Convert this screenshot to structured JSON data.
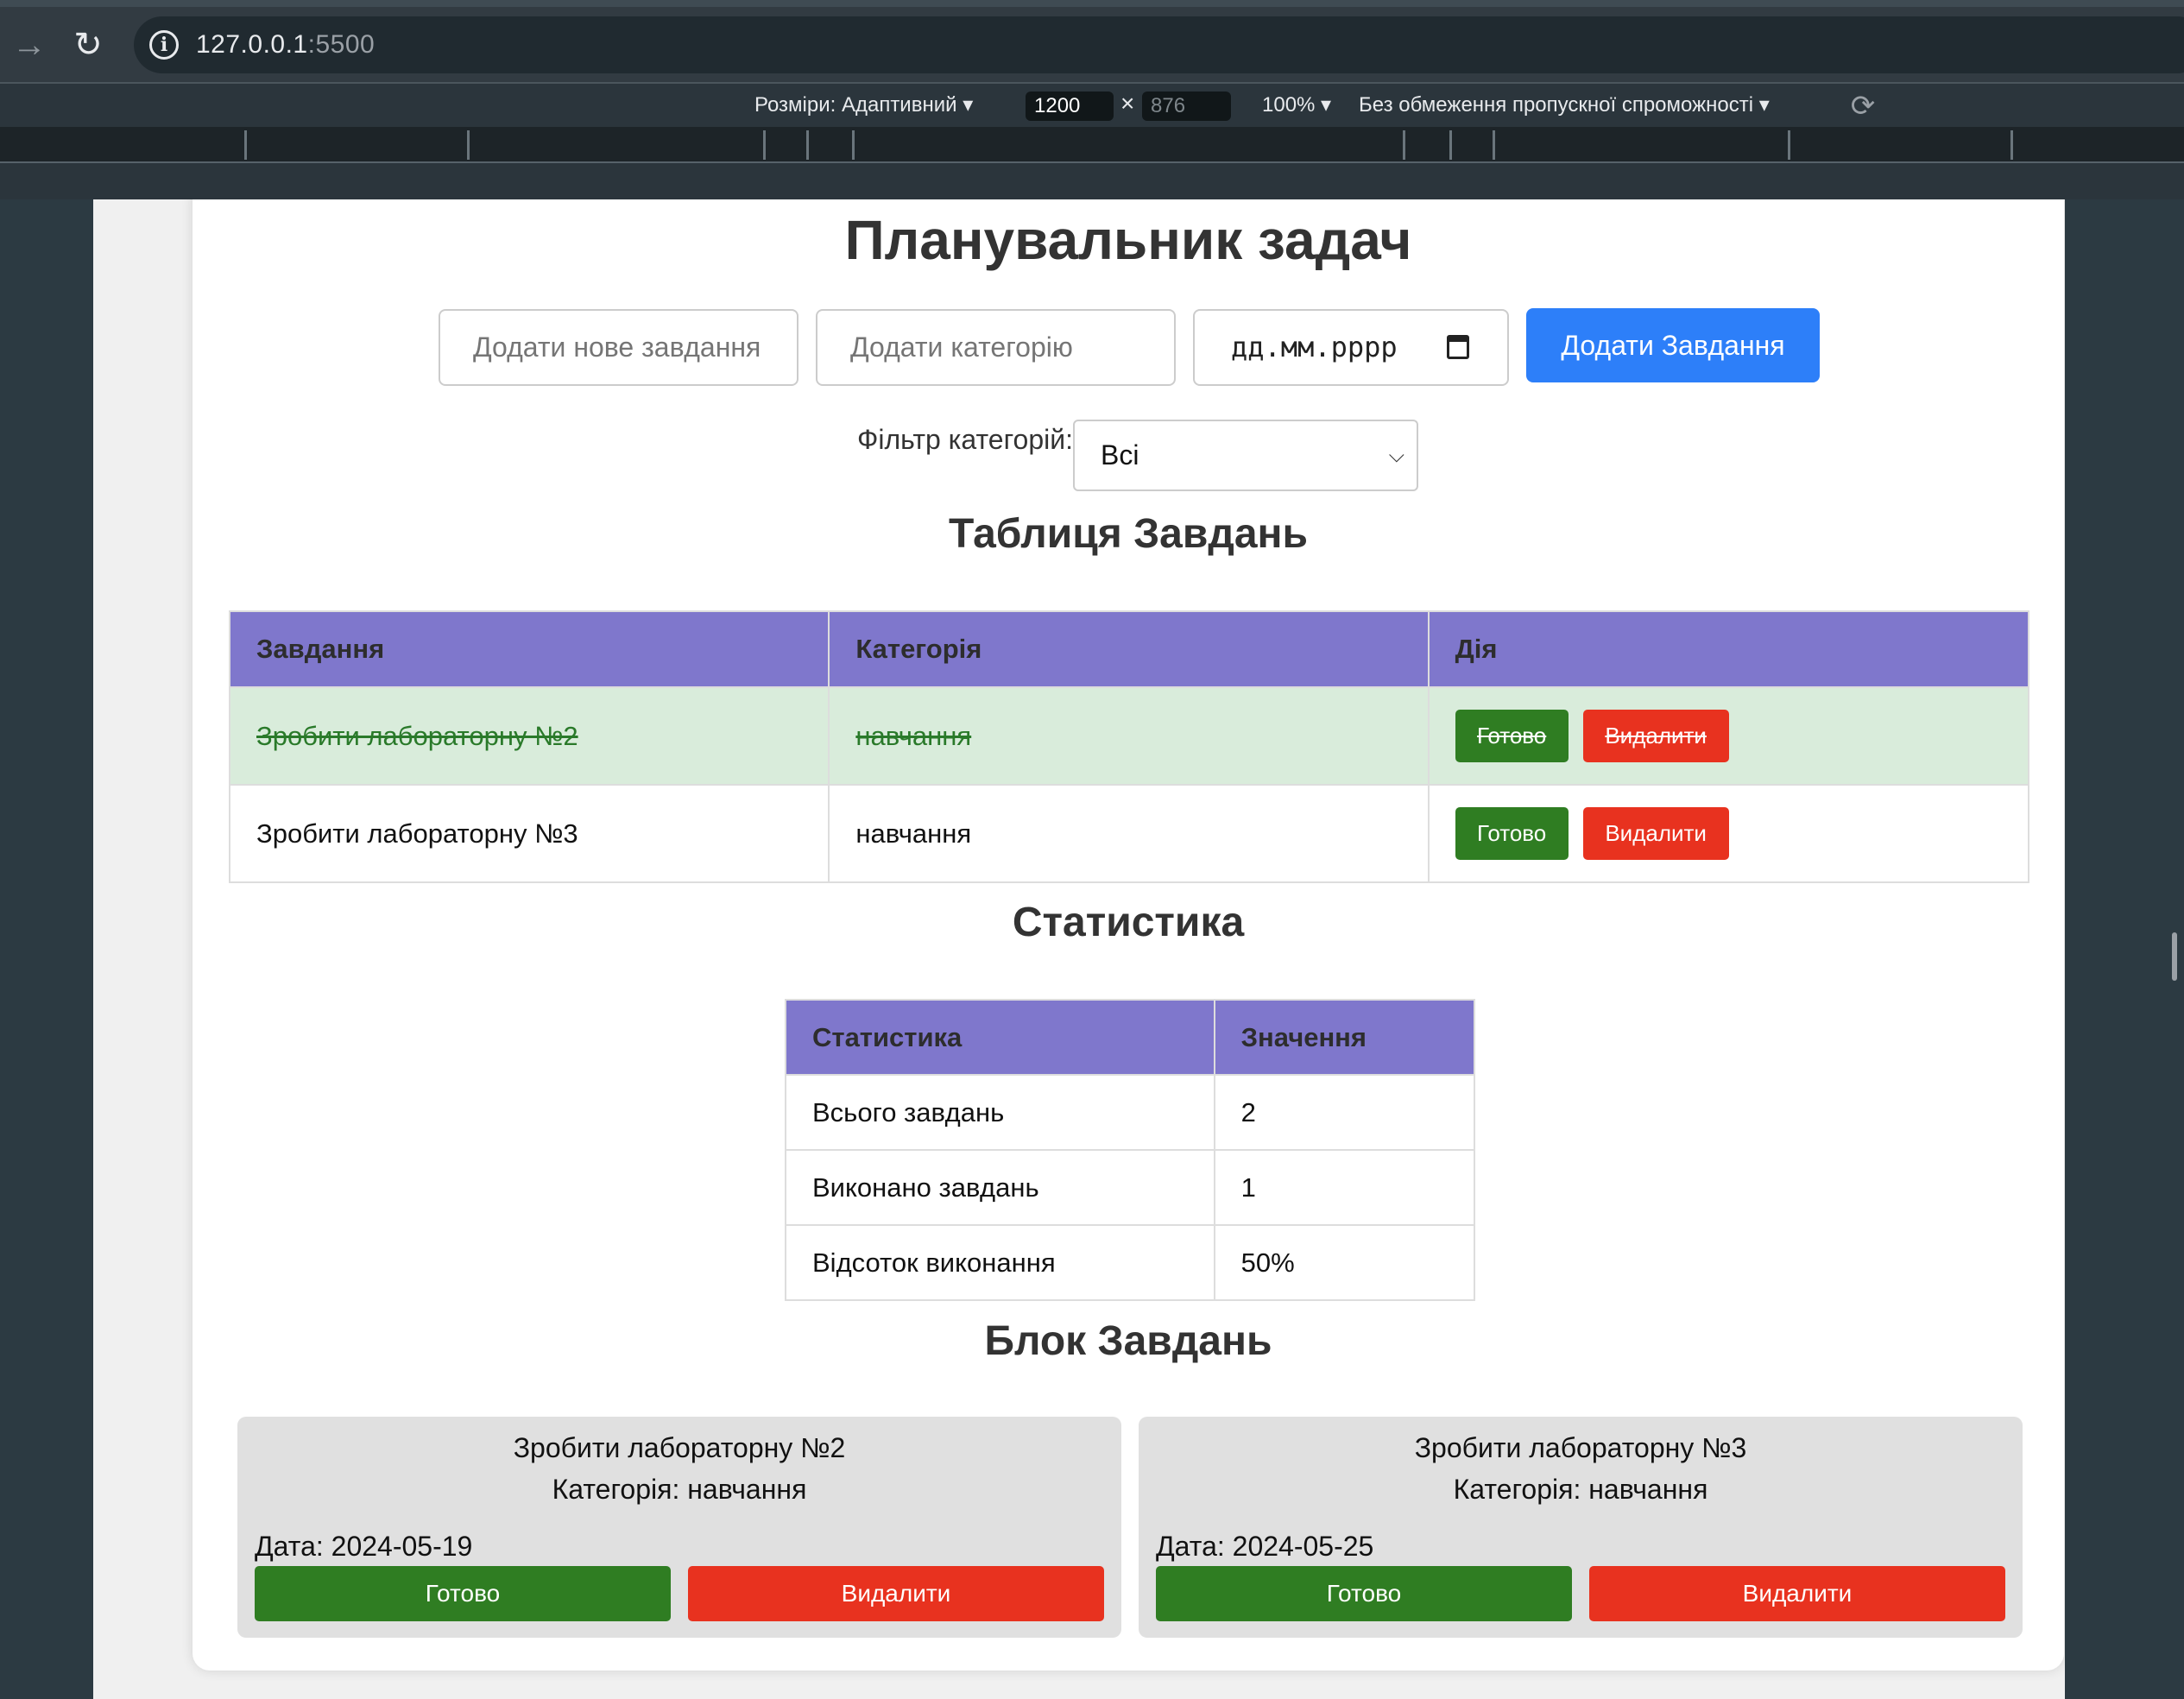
{
  "browser": {
    "url_host": "127.0.0.1",
    "url_port": ":5500"
  },
  "device_toolbar": {
    "dimensions_label": "Розміри: Адаптивний",
    "width_value": "1200",
    "height_value": "876",
    "times": "×",
    "zoom_label": "100%",
    "throttle_label": "Без обмеження пропускної спроможності"
  },
  "page": {
    "title": "Планувальник задач",
    "inputs": {
      "task_placeholder": "Додати нове завдання",
      "category_placeholder": "Додати категорію",
      "date_placeholder": "дд.мм.рррр"
    },
    "add_button": "Додати Завдання",
    "filter": {
      "label": "Фільтр категорій:",
      "selected": "Всі"
    },
    "task_table": {
      "heading": "Таблиця Завдань",
      "headers": [
        "Завдання",
        "Категорія",
        "Дія"
      ],
      "rows": [
        {
          "task": "Зробити лабораторну №2",
          "category": "навчання",
          "done": true,
          "done_label": "Готово",
          "delete_label": "Видалити"
        },
        {
          "task": "Зробити лабораторну №3",
          "category": "навчання",
          "done": false,
          "done_label": "Готово",
          "delete_label": "Видалити"
        }
      ]
    },
    "stats": {
      "heading": "Статистика",
      "headers": [
        "Статистика",
        "Значення"
      ],
      "rows": [
        {
          "label": "Всього завдань",
          "value": "2"
        },
        {
          "label": "Виконано завдань",
          "value": "1"
        },
        {
          "label": "Відсоток виконання",
          "value": "50%"
        }
      ]
    },
    "task_block": {
      "heading": "Блок Завдань",
      "cards": [
        {
          "title": "Зробити лабораторну №2",
          "category": "Категорія: навчання",
          "date": "Дата: 2024-05-19",
          "done_label": "Готово",
          "delete_label": "Видалити"
        },
        {
          "title": "Зробити лабораторну №3",
          "category": "Категорія: навчання",
          "date": "Дата: 2024-05-25",
          "done_label": "Готово",
          "delete_label": "Видалити"
        }
      ]
    }
  },
  "colors": {
    "primary_button": "#2d7ff9",
    "table_header": "#7f77cc",
    "done_green": "#2f7d22",
    "delete_red": "#e8321f",
    "done_row_bg": "#d9ecdb",
    "card_bg": "#e0e0e0"
  }
}
